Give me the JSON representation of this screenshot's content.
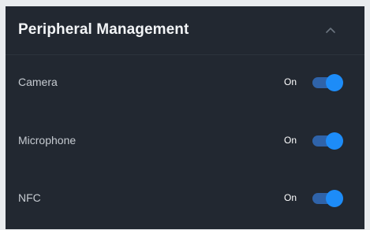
{
  "panel": {
    "title": "Peripheral Management",
    "collapse_icon": "chevron-up-icon"
  },
  "colors": {
    "panel_background": "#222831",
    "toggle_on_knob": "#1d8cf8",
    "toggle_on_track": "#2f63a9"
  },
  "settings": [
    {
      "label": "Camera",
      "state": "On",
      "enabled": true
    },
    {
      "label": "Microphone",
      "state": "On",
      "enabled": true
    },
    {
      "label": "NFC",
      "state": "On",
      "enabled": true
    }
  ]
}
